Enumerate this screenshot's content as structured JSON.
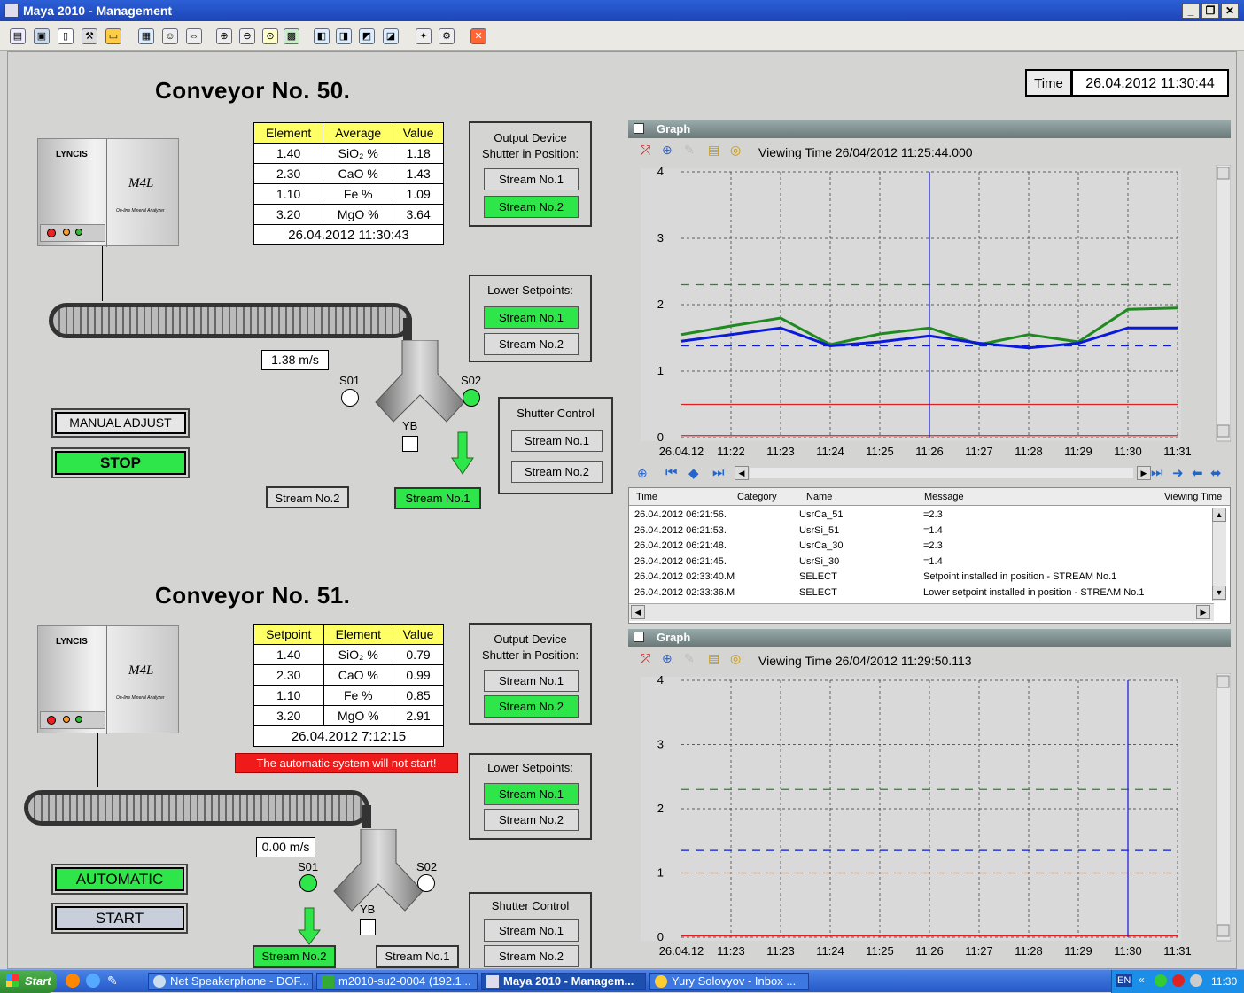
{
  "window": {
    "title": "Maya 2010 - Management"
  },
  "time": {
    "label": "Time",
    "value": "26.04.2012 11:30:44"
  },
  "conveyor50": {
    "title": "Conveyor No. 50.",
    "analyzer": {
      "brand": "LYNCIS",
      "model": "M4L",
      "sub": "On-line Mineral Analyzer"
    },
    "table": {
      "headers": [
        "Element",
        "Average",
        "Value"
      ],
      "rows": [
        [
          "1.40",
          "SiO₂ %",
          "1.18"
        ],
        [
          "2.30",
          "CaO %",
          "1.43"
        ],
        [
          "1.10",
          "Fe %",
          "1.09"
        ],
        [
          "3.20",
          "MgO %",
          "3.64"
        ]
      ],
      "timestamp": "26.04.2012 11:30:43"
    },
    "output": {
      "title": "Output Device Shutter in Position:",
      "s1": "Stream No.1",
      "s2": "Stream No.2"
    },
    "lower": {
      "title": "Lower Setpoints:",
      "s1": "Stream No.1",
      "s2": "Stream No.2"
    },
    "shutter": {
      "title": "Shutter Control",
      "s1": "Stream No.1",
      "s2": "Stream No.2"
    },
    "speed": "1.38 m/s",
    "s01": "S01",
    "s02": "S02",
    "yb": "YB",
    "out_left": "Stream No.2",
    "out_right": "Stream No.1",
    "btn_mode": "MANUAL ADJUST",
    "btn_action": "STOP"
  },
  "conveyor51": {
    "title": "Conveyor No. 51.",
    "analyzer": {
      "brand": "LYNCIS",
      "model": "M4L",
      "sub": "On-line Mineral Analyzer"
    },
    "table": {
      "headers": [
        "Setpoint",
        "Element",
        "Value"
      ],
      "rows": [
        [
          "1.40",
          "SiO₂ %",
          "0.79"
        ],
        [
          "2.30",
          "CaO %",
          "0.99"
        ],
        [
          "1.10",
          "Fe %",
          "0.85"
        ],
        [
          "3.20",
          "MgO %",
          "2.91"
        ]
      ],
      "timestamp": "26.04.2012 7:12:15"
    },
    "alert": "The automatic system will not start!",
    "output": {
      "title": "Output Device Shutter in Position:",
      "s1": "Stream No.1",
      "s2": "Stream No.2"
    },
    "lower": {
      "title": "Lower Setpoints:",
      "s1": "Stream No.1",
      "s2": "Stream No.2"
    },
    "shutter": {
      "title": "Shutter Control",
      "s1": "Stream No.1",
      "s2": "Stream No.2"
    },
    "speed": "0.00 m/s",
    "s01": "S01",
    "s02": "S02",
    "yb": "YB",
    "out_left": "Stream No.2",
    "out_right": "Stream No.1",
    "btn_mode": "AUTOMATIC",
    "btn_action": "START"
  },
  "graph1": {
    "header": "Graph",
    "viewing": "Viewing Time 26/04/2012 11:25:44.000"
  },
  "graph2": {
    "header": "Graph",
    "viewing": "Viewing Time 26/04/2012 11:29:50.113"
  },
  "messages": {
    "headers": [
      "Time",
      "Category",
      "Name",
      "Message",
      "Viewing Time"
    ],
    "rows": [
      [
        "26.04.2012 06:21:56.",
        "",
        "UsrCa_51",
        "=2.3"
      ],
      [
        "26.04.2012 06:21:53.",
        "",
        "UsrSi_51",
        "=1.4"
      ],
      [
        "26.04.2012 06:21:48.",
        "",
        "UsrCa_30",
        "=2.3"
      ],
      [
        "26.04.2012 06:21:45.",
        "",
        "UsrSi_30",
        "=1.4"
      ],
      [
        "26.04.2012 02:33:40.M",
        "",
        "SELECT",
        "Setpoint installed in position - STREAM No.1"
      ],
      [
        "26.04.2012 02:33:36.M",
        "",
        "SELECT",
        "Lower setpoint installed in position - STREAM No.1"
      ]
    ]
  },
  "chart_data": [
    {
      "type": "line",
      "x": [
        "26.04.12",
        "11:22",
        "11:23",
        "11:24",
        "11:25",
        "11:26",
        "11:27",
        "11:28",
        "11:29",
        "11:30",
        "11:31"
      ],
      "ylim": [
        0,
        4
      ],
      "yticks": [
        "0",
        "1",
        "2",
        "3",
        "4"
      ],
      "grid": true,
      "series": [
        {
          "color": "#1f8a1f",
          "values": [
            1.55,
            1.68,
            1.8,
            1.4,
            1.56,
            1.65,
            1.4,
            1.55,
            1.44,
            1.93,
            1.95
          ]
        },
        {
          "color": "#0a1ad8",
          "values": [
            1.45,
            1.55,
            1.65,
            1.38,
            1.44,
            1.53,
            1.42,
            1.35,
            1.42,
            1.65,
            1.65
          ]
        }
      ],
      "reference_lines": [
        {
          "y": 2.3,
          "color": "#1f8a1f",
          "style": "dashed"
        },
        {
          "y": 1.38,
          "color": "#0a1ad8",
          "style": "dashed"
        },
        {
          "y": 0.5,
          "color": "#e02020",
          "style": "solid"
        },
        {
          "y": 0.03,
          "color": "#e02020",
          "style": "solid"
        }
      ],
      "cursor_x": "11:26"
    },
    {
      "type": "line",
      "x": [
        "26.04.12",
        "11:23",
        "11:23",
        "11:24",
        "11:25",
        "11:26",
        "11:27",
        "11:28",
        "11:29",
        "11:30",
        "11:31"
      ],
      "ylim": [
        0,
        4
      ],
      "yticks": [
        "0",
        "1",
        "2",
        "3",
        "4"
      ],
      "grid": true,
      "series": [],
      "reference_lines": [
        {
          "y": 2.3,
          "color": "#1f8a1f",
          "style": "dashed"
        },
        {
          "y": 1.35,
          "color": "#0a1ad8",
          "style": "dashed"
        },
        {
          "y": 1.0,
          "color": "#e07a20",
          "style": "dashed"
        },
        {
          "y": 0.02,
          "color": "#e02020",
          "style": "solid"
        }
      ],
      "cursor_x": "11:30"
    }
  ],
  "taskbar": {
    "start": "Start",
    "tasks": [
      "Net Speakerphone - DOF...",
      "m2010-su2-0004 (192.1...",
      "Maya 2010 - Managem...",
      "Yury Solovyov - Inbox ..."
    ],
    "lang": "EN",
    "clock": "11:30"
  }
}
